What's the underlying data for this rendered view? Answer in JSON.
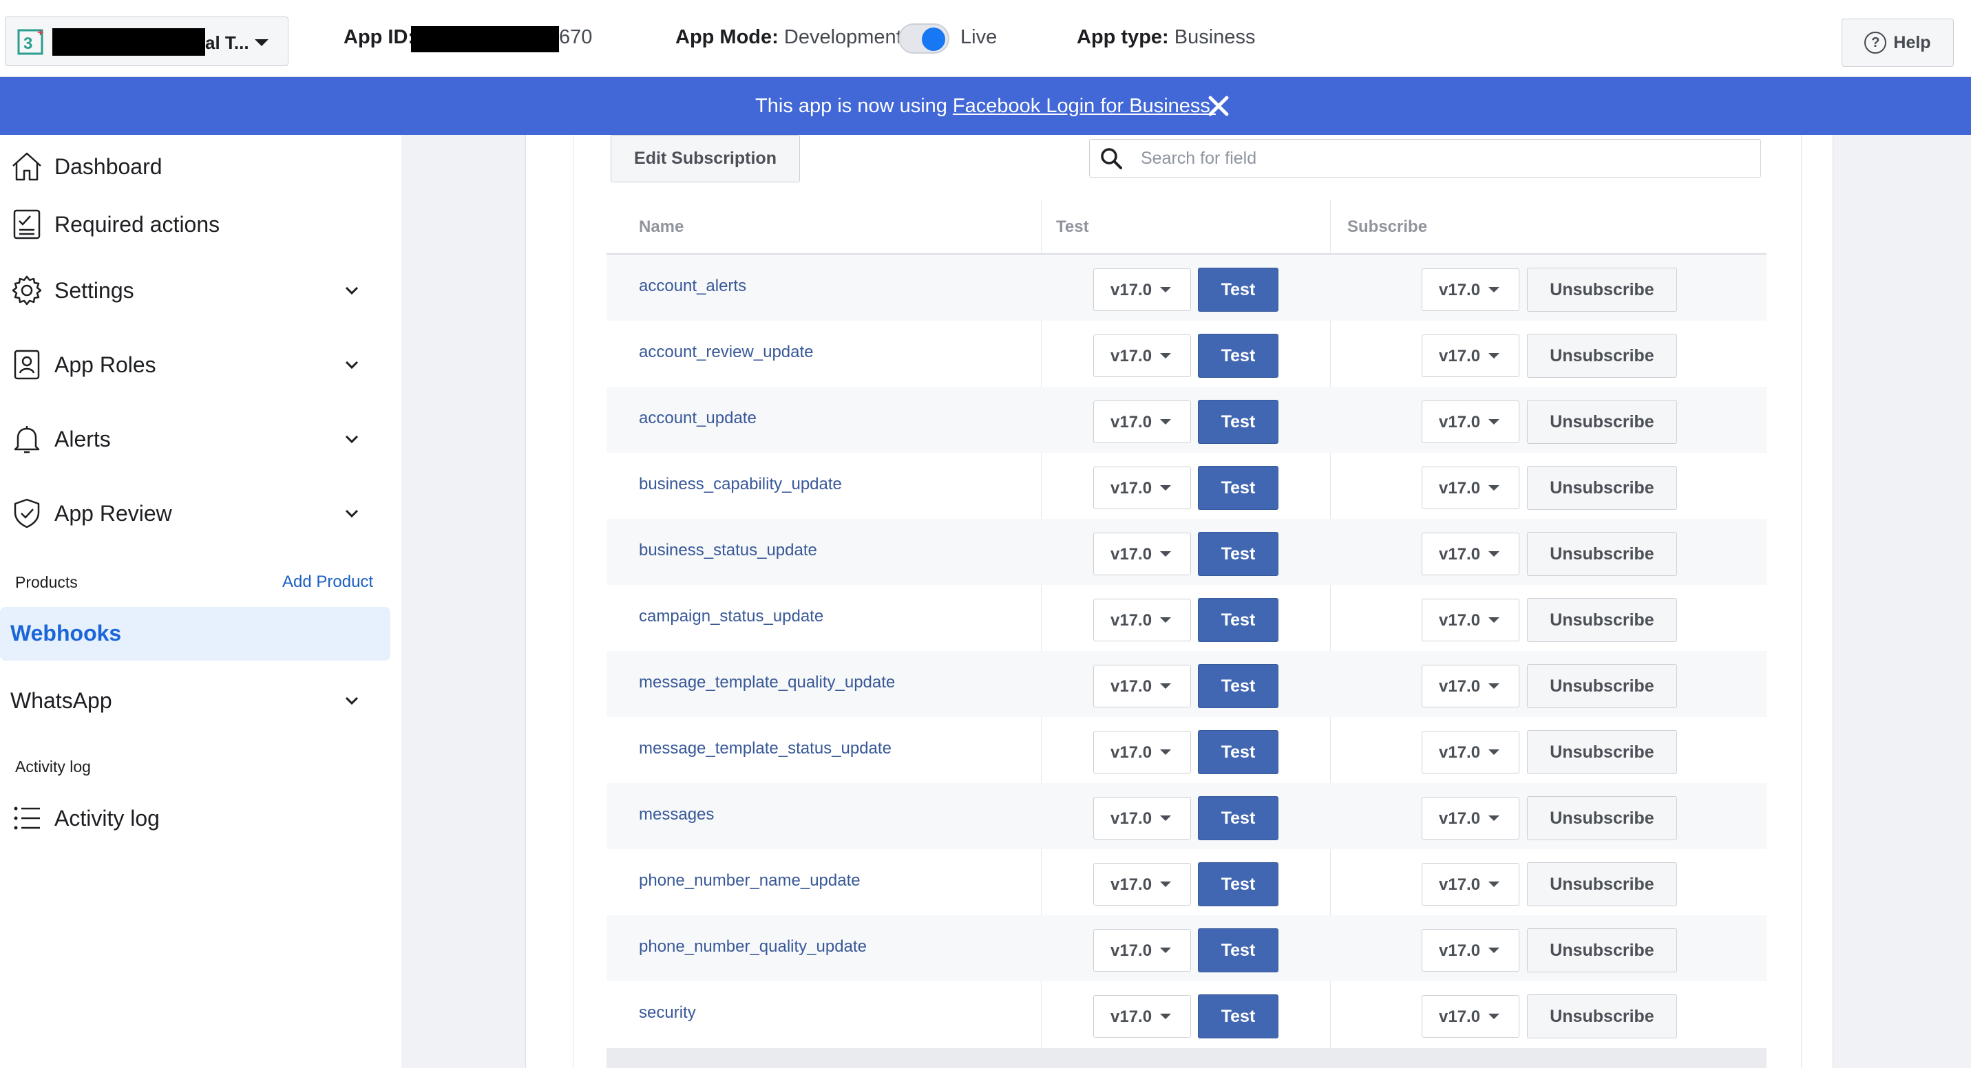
{
  "topbar": {
    "app_name_tail": "al T...",
    "app_id_label": "App ID:",
    "app_id_tail": "670",
    "app_mode_label": "App Mode:",
    "app_mode_value": "Development",
    "app_mode_live": "Live",
    "app_type_label": "App type:",
    "app_type_value": "Business",
    "help_label": "Help"
  },
  "banner": {
    "text": "This app is now using",
    "link": "Facebook Login for Business."
  },
  "sidebar": {
    "items": [
      {
        "label": "Dashboard",
        "icon": "house-icon"
      },
      {
        "label": "Required actions",
        "icon": "checklist-icon"
      },
      {
        "label": "Settings",
        "icon": "gear-icon"
      },
      {
        "label": "App Roles",
        "icon": "id-badge-icon"
      },
      {
        "label": "Alerts",
        "icon": "bell-icon"
      },
      {
        "label": "App Review",
        "icon": "shield-check-icon"
      }
    ],
    "products_title": "Products",
    "add_product": "Add Product",
    "active_item": "Webhooks",
    "whatsapp": "WhatsApp",
    "activity_title": "Activity log",
    "activity_item": "Activity log"
  },
  "toolbar": {
    "edit_subscription": "Edit Subscription",
    "search_placeholder": "Search for field"
  },
  "table": {
    "headers": {
      "name": "Name",
      "test": "Test",
      "subscribe": "Subscribe"
    },
    "test_label": "Test",
    "unsubscribe_label": "Unsubscribe",
    "rows": [
      {
        "name": "account_alerts",
        "test_version": "v17.0",
        "sub_version": "v17.0"
      },
      {
        "name": "account_review_update",
        "test_version": "v17.0",
        "sub_version": "v17.0"
      },
      {
        "name": "account_update",
        "test_version": "v17.0",
        "sub_version": "v17.0"
      },
      {
        "name": "business_capability_update",
        "test_version": "v17.0",
        "sub_version": "v17.0"
      },
      {
        "name": "business_status_update",
        "test_version": "v17.0",
        "sub_version": "v17.0"
      },
      {
        "name": "campaign_status_update",
        "test_version": "v17.0",
        "sub_version": "v17.0"
      },
      {
        "name": "message_template_quality_update",
        "test_version": "v17.0",
        "sub_version": "v17.0"
      },
      {
        "name": "message_template_status_update",
        "test_version": "v17.0",
        "sub_version": "v17.0"
      },
      {
        "name": "messages",
        "test_version": "v17.0",
        "sub_version": "v17.0"
      },
      {
        "name": "phone_number_name_update",
        "test_version": "v17.0",
        "sub_version": "v17.0"
      },
      {
        "name": "phone_number_quality_update",
        "test_version": "v17.0",
        "sub_version": "v17.0"
      },
      {
        "name": "security",
        "test_version": "v17.0",
        "sub_version": "v17.0"
      }
    ]
  },
  "colors": {
    "banner": "#4267d6",
    "test_button": "#4267b2",
    "active_nav": "#1a66d9",
    "link": "#385898"
  }
}
